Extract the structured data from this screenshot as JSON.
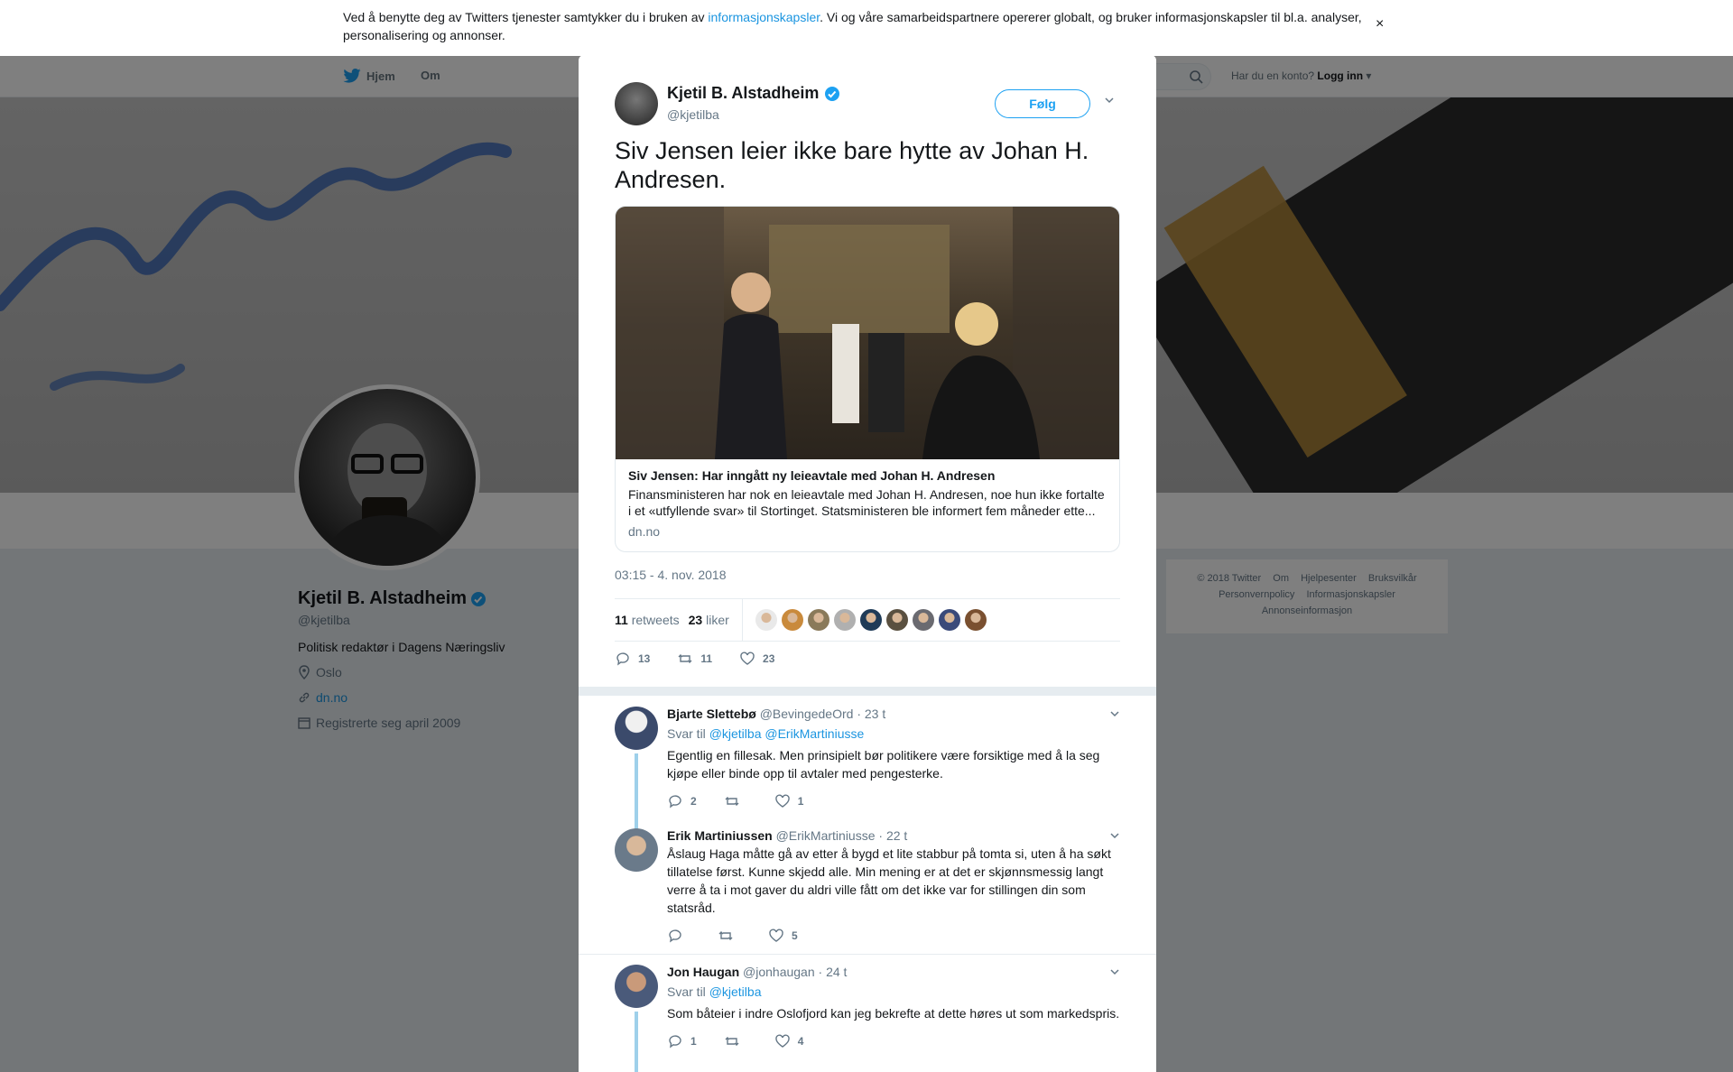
{
  "cookie": {
    "text_before": "Ved å benytte deg av Twitters tjenester samtykker du i bruken av ",
    "link": "informasjonskapsler",
    "text_after": ". Vi og våre samarbeidspartnere opererer globalt, og bruker informasjonskapsler til bl.a. analyser, personalisering og annonser.",
    "close": "×"
  },
  "modal_close": "×",
  "nav": {
    "home": "Hjem",
    "about": "Om",
    "account_prompt": "Har du en konto?",
    "login": "Logg inn"
  },
  "profile": {
    "name": "Kjetil B. Alstadheim",
    "handle": "@kjetilba",
    "bio": "Politisk redaktør i Dagens Næringsliv",
    "location": "Oslo",
    "website": "dn.no",
    "joined": "Registrerte seg april 2009"
  },
  "footer": {
    "items": [
      "© 2018 Twitter",
      "Om",
      "Hjelpesenter",
      "Bruksvilkår",
      "Personvernpolicy",
      "Informasjonskapsler",
      "Annonseinformasjon"
    ]
  },
  "tweet": {
    "name": "Kjetil B. Alstadheim",
    "handle": "@kjetilba",
    "follow": "Følg",
    "text": "Siv Jensen leier ikke bare hytte av Johan H. Andresen.",
    "card": {
      "title": "Siv Jensen: Har inngått ny leieavtale med Johan H. Andresen",
      "description": "Finansministeren har nok en leieavtale med Johan H. Andresen, noe hun ikke fortalte i et «utfyllende svar» til Stortinget. Statsministeren ble informert fem måneder ette...",
      "domain": "dn.no"
    },
    "time": "03:15 - 4. nov. 2018",
    "retweets_count": "11",
    "retweets_label": "retweets",
    "likes_count": "23",
    "likes_label": "liker",
    "actions": {
      "replies": "13",
      "retweets": "11",
      "likes": "23"
    },
    "liker_colors": [
      "#e9e9e9",
      "#c98a3c",
      "#8a7a5a",
      "#b0b0b0",
      "#1f3b57",
      "#5a5040",
      "#6a6a70",
      "#3a4a7a",
      "#7a5030"
    ]
  },
  "replies": [
    {
      "name": "Bjarte Slettebø",
      "handle": "@BevingedeOrd",
      "time": "· 23 t",
      "to_label": "Svar til",
      "to": "@kjetilba @ErikMartiniusse",
      "text": "Egentlig en fillesak. Men prinsipielt bør politikere være forsiktige med å la seg kjøpe eller binde opp til avtaler med pengesterke.",
      "replies": "2",
      "retweets": "",
      "likes": "1",
      "avatar_color": "#3b4a6b"
    },
    {
      "name": "Erik Martiniussen",
      "handle": "@ErikMartiniusse",
      "time": "· 22 t",
      "text": "Åslaug Haga måtte gå av etter å bygd et lite stabbur på tomta si, uten å ha søkt tillatelse først. Kunne skjedd alle. Min mening er at det er skjønnsmessig langt verre å ta i mot gaver du aldri ville fått om det ikke var for stillingen din som statsråd.",
      "replies": "",
      "retweets": "",
      "likes": "5",
      "avatar_color": "#6a7a8a"
    },
    {
      "name": "Jon Haugan",
      "handle": "@jonhaugan",
      "time": "· 24 t",
      "to_label": "Svar til",
      "to": "@kjetilba",
      "text": "Som båteier i indre Oslofjord kan jeg bekrefte at dette høres ut som markedspris.",
      "replies": "1",
      "retweets": "",
      "likes": "4",
      "avatar_color": "#4a5a7a"
    }
  ],
  "colors": {
    "accent": "#1da1f2",
    "link": "#1b95e0",
    "verified": "#1da1f2"
  }
}
